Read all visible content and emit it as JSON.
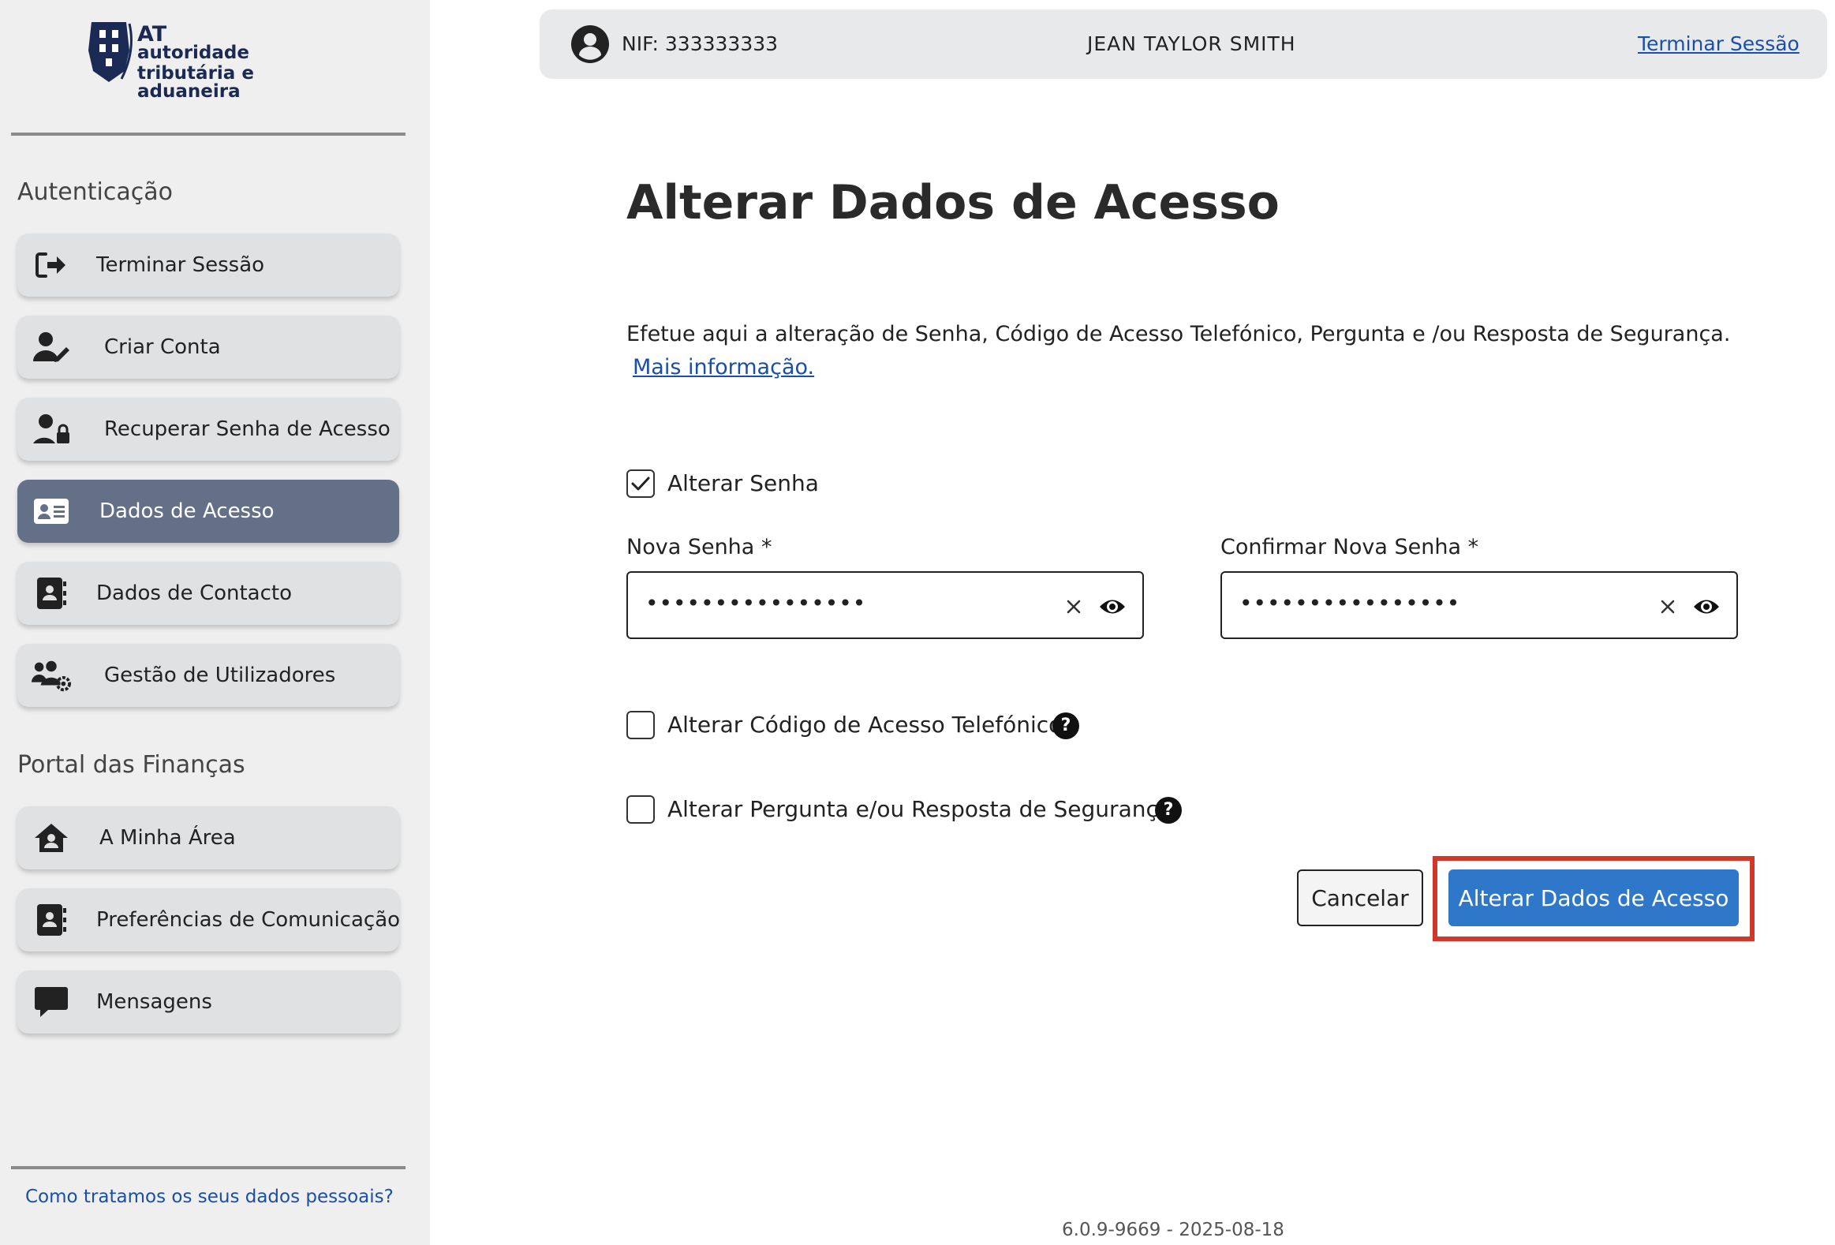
{
  "logo": {
    "line1": "AT",
    "line2": "autoridade",
    "line3": "tributária e aduaneira"
  },
  "sidebar": {
    "section_auth": "Autenticação",
    "auth_items": [
      {
        "label": "Terminar Sessão",
        "icon": "sign-out-icon"
      },
      {
        "label": "Criar Conta",
        "icon": "user-edit-icon"
      },
      {
        "label": "Recuperar Senha de Acesso",
        "icon": "user-lock-icon"
      },
      {
        "label": "Dados de Acesso",
        "icon": "id-card-icon",
        "active": true
      },
      {
        "label": "Dados de Contacto",
        "icon": "contact-book-icon"
      },
      {
        "label": "Gestão de Utilizadores",
        "icon": "users-cog-icon"
      }
    ],
    "section_portal": "Portal das Finanças",
    "portal_items": [
      {
        "label": "A Minha Área",
        "icon": "house-user-icon"
      },
      {
        "label": "Preferências de Comunicação",
        "icon": "contact-book-icon"
      },
      {
        "label": "Mensagens",
        "icon": "message-icon"
      }
    ],
    "privacy_link": "Como tratamos os seus dados pessoais?"
  },
  "header": {
    "nif": "NIF: 333333333",
    "user_name": "JEAN TAYLOR SMITH",
    "logout": "Terminar Sessão"
  },
  "main": {
    "title": "Alterar Dados de Acesso",
    "description": "Efetue aqui a alteração de Senha, Código de Acesso Telefónico, Pergunta e /ou Resposta de Segurança.",
    "more_info": "Mais informação.",
    "change_password": {
      "label": "Alterar Senha",
      "checked": true
    },
    "new_password": {
      "label": "Nova Senha",
      "required_mark": "*",
      "value": "••••••••••••••••"
    },
    "confirm_password": {
      "label": "Confirmar Nova Senha",
      "required_mark": "*",
      "value": "••••••••••••••••"
    },
    "change_phone_code": {
      "label": "Alterar Código de Acesso Telefónico",
      "checked": false,
      "help": "?"
    },
    "change_security": {
      "label": "Alterar Pergunta e/ou Resposta de Segurança",
      "checked": false,
      "help": "?"
    },
    "cancel": "Cancelar",
    "submit": "Alterar Dados de Acesso"
  },
  "footer": {
    "version": "6.0.9-9669 - 2025-08-18"
  },
  "colors": {
    "primary": "#2f78c9",
    "active_nav": "#646f88",
    "link": "#1a4fa8",
    "highlight": "#d0382a"
  }
}
